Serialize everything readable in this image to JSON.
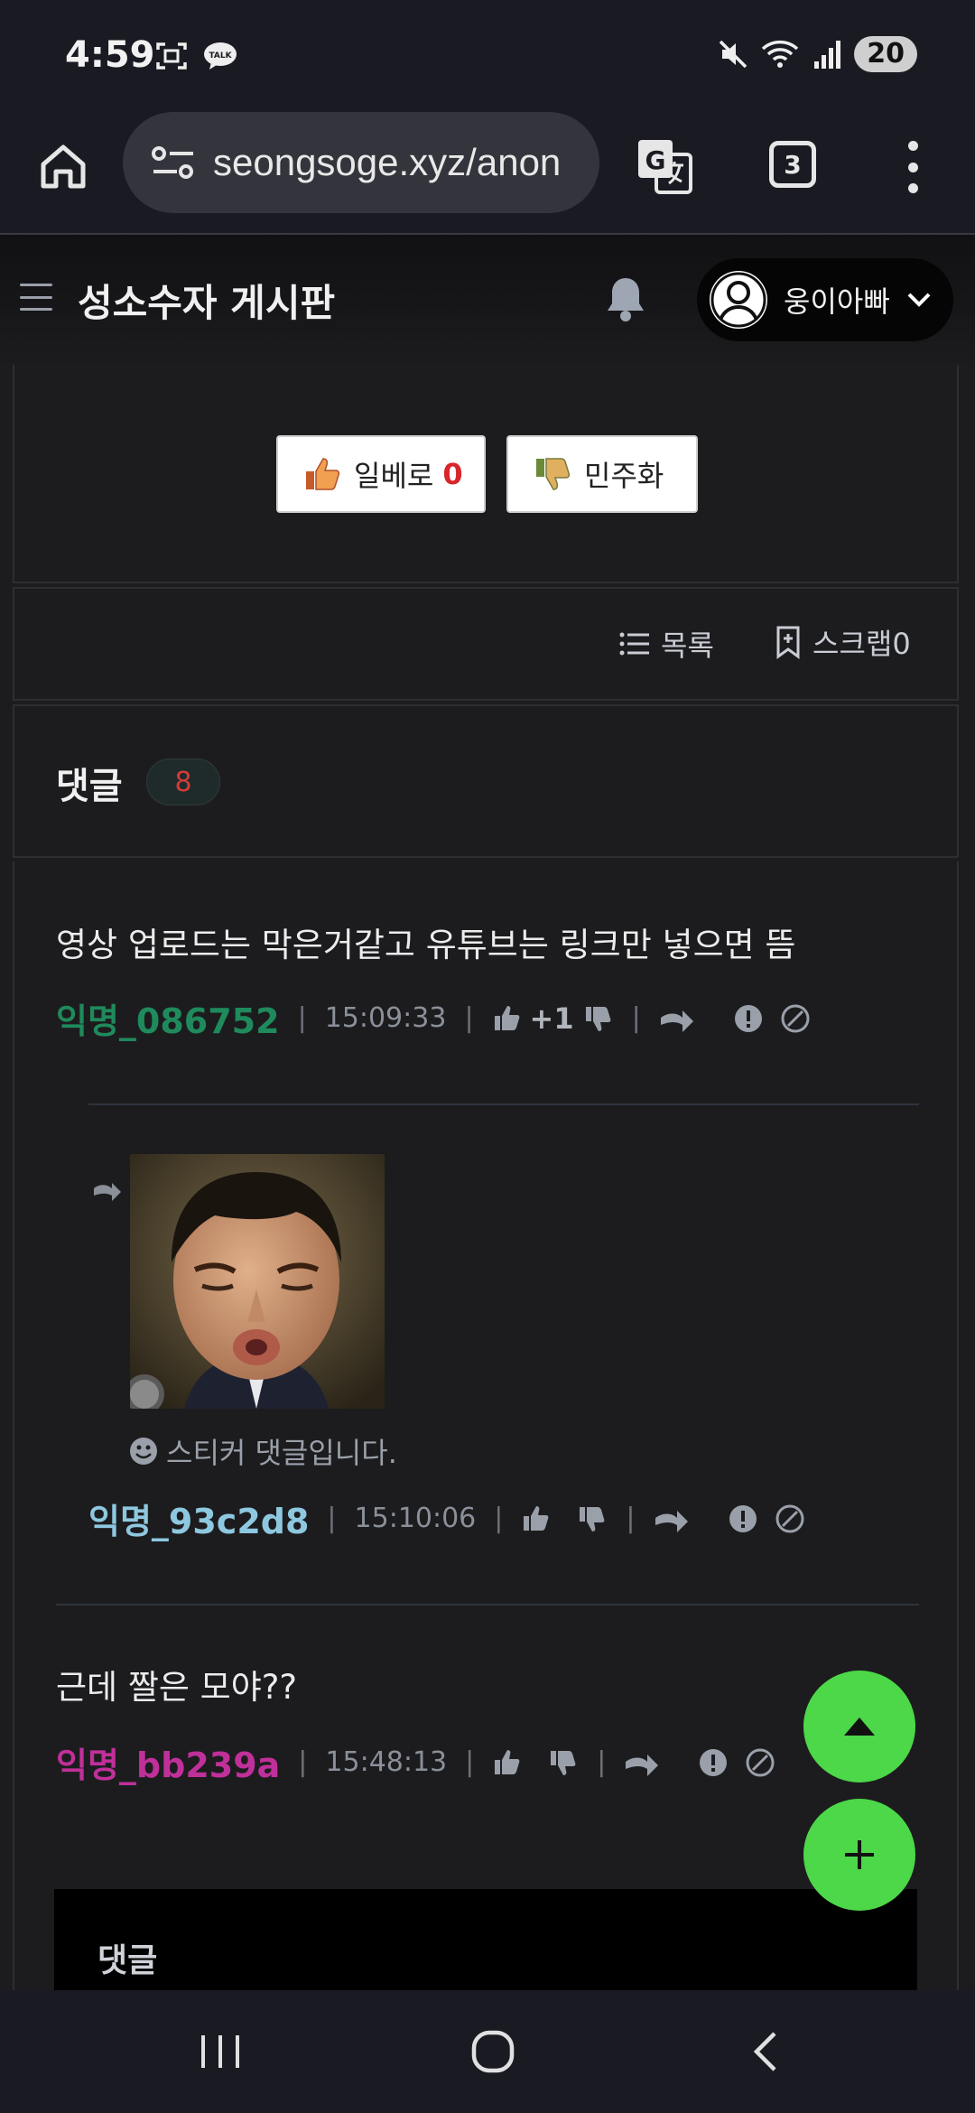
{
  "status_bar": {
    "time": "4:59",
    "battery": "20"
  },
  "browser": {
    "url": "seongsoge.xyz/anon",
    "tab_count": "3"
  },
  "header": {
    "title": "성소수자 게시판",
    "username": "웅이아빠"
  },
  "vote": {
    "up_label": "일베로",
    "up_count": "0",
    "down_label": "민주화"
  },
  "actions": {
    "list_label": "목록",
    "scrap_label": "스크랩",
    "scrap_count": "0"
  },
  "comments_header": {
    "title": "댓글",
    "count": "8"
  },
  "comments": [
    {
      "text": "영상 업로드는 막은거같고 유튜브는 링크만 넣으면 뜸",
      "author": "익명_086752",
      "author_color": "#1f8a5c",
      "time": "15:09:33",
      "likes": "+1"
    },
    {
      "sticker_note": "스티커 댓글입니다.",
      "author": "익명_93c2d8",
      "author_color": "#8ec8e0",
      "time": "15:10:06"
    },
    {
      "text": "근데 짤은 모야??",
      "author": "익명_bb239a",
      "author_color": "#c0309a",
      "time": "15:48:13"
    }
  ],
  "reply_form": {
    "title": "댓글"
  },
  "colors": {
    "fab": "#4cd848",
    "vote_count": "#d8262b"
  }
}
